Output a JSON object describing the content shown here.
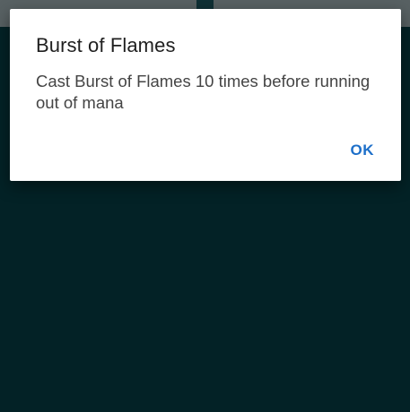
{
  "dialog": {
    "title": "Burst of Flames",
    "message": "Cast Burst of Flames 10 times before running out of mana",
    "ok_label": "OK"
  },
  "colors": {
    "background": "#032226",
    "scrim_topbar": "#586163",
    "dialog_bg": "#ffffff",
    "accent": "#1d6fc9"
  }
}
